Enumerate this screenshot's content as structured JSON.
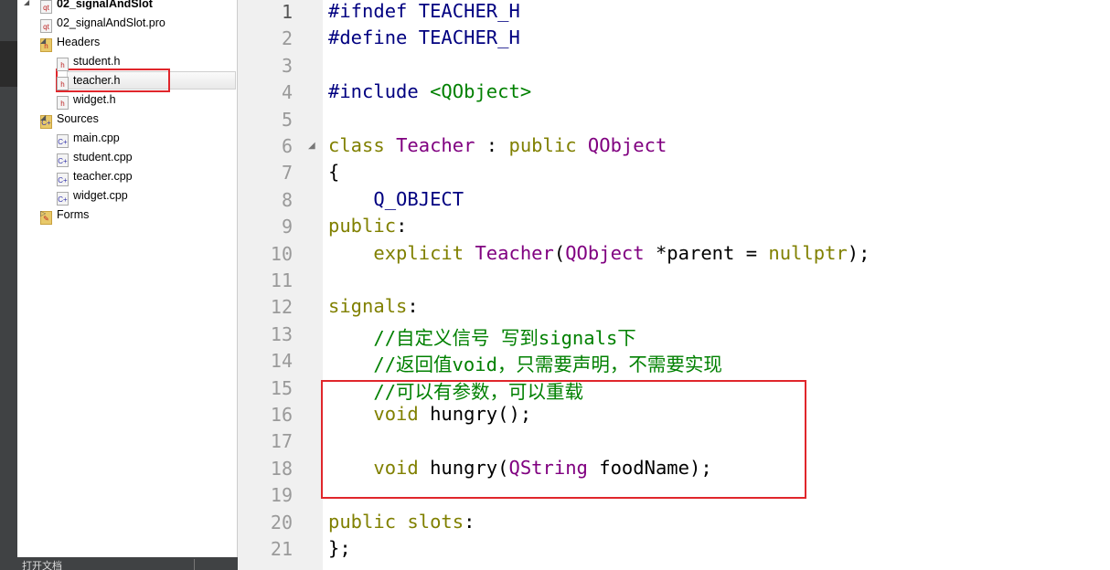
{
  "project": {
    "name": "02_signalAndSlot",
    "items": [
      {
        "label": "02_signalAndSlot.pro",
        "icon": "qt-project-file-icon"
      },
      {
        "label": "Headers",
        "icon": "headers-folder-icon"
      },
      {
        "label": "student.h",
        "icon": "header-file-icon"
      },
      {
        "label": "teacher.h",
        "icon": "header-file-icon",
        "selected": true
      },
      {
        "label": "widget.h",
        "icon": "header-file-icon"
      },
      {
        "label": "Sources",
        "icon": "sources-folder-icon"
      },
      {
        "label": "main.cpp",
        "icon": "cpp-file-icon"
      },
      {
        "label": "student.cpp",
        "icon": "cpp-file-icon"
      },
      {
        "label": "teacher.cpp",
        "icon": "cpp-file-icon"
      },
      {
        "label": "widget.cpp",
        "icon": "cpp-file-icon"
      },
      {
        "label": "Forms",
        "icon": "forms-folder-icon"
      }
    ]
  },
  "bottom_panel": {
    "label": "打开文档"
  },
  "editor": {
    "lines": [
      [
        [
          "pp",
          "#ifndef TEACHER_H"
        ]
      ],
      [
        [
          "pp",
          "#define TEACHER_H"
        ]
      ],
      [],
      [
        [
          "pp",
          "#include "
        ],
        [
          "inc",
          "<QObject>"
        ]
      ],
      [],
      [
        [
          "kw",
          "class "
        ],
        [
          "cl",
          "Teacher"
        ],
        [
          "",
          " : "
        ],
        [
          "kw",
          "public "
        ],
        [
          "cl",
          "QObject"
        ]
      ],
      [
        [
          "",
          "{"
        ]
      ],
      [
        [
          "pp",
          "    Q_OBJECT"
        ]
      ],
      [
        [
          "kw",
          "public"
        ],
        [
          "",
          ":"
        ]
      ],
      [
        [
          "kw",
          "    explicit "
        ],
        [
          "cl",
          "Teacher"
        ],
        [
          "",
          "("
        ],
        [
          "cl",
          "QObject"
        ],
        [
          "",
          " *parent = "
        ],
        [
          "kw",
          "nullptr"
        ],
        [
          "",
          ");"
        ]
      ],
      [],
      [
        [
          "kw",
          "signals"
        ],
        [
          "",
          ":"
        ]
      ],
      [
        [
          "cm",
          "    //自定义信号 写到signals下"
        ]
      ],
      [
        [
          "cm",
          "    //返回值void，只需要声明，不需要实现"
        ]
      ],
      [
        [
          "cm",
          "    //可以有参数，可以重载"
        ]
      ],
      [
        [
          "kw",
          "    void "
        ],
        [
          "",
          "hungry();"
        ]
      ],
      [],
      [
        [
          "kw",
          "    void "
        ],
        [
          "",
          "hungry("
        ],
        [
          "cl",
          "QString"
        ],
        [
          "",
          " foodName);"
        ]
      ],
      [],
      [
        [
          "kw",
          "public slots"
        ],
        [
          "",
          ":"
        ]
      ],
      [
        [
          "",
          "};"
        ]
      ]
    ]
  },
  "colors": {
    "keyword": "#808000",
    "preprocessor": "#000080",
    "type": "#800080",
    "comment": "#008000",
    "highlight_box": "#e0262b"
  }
}
